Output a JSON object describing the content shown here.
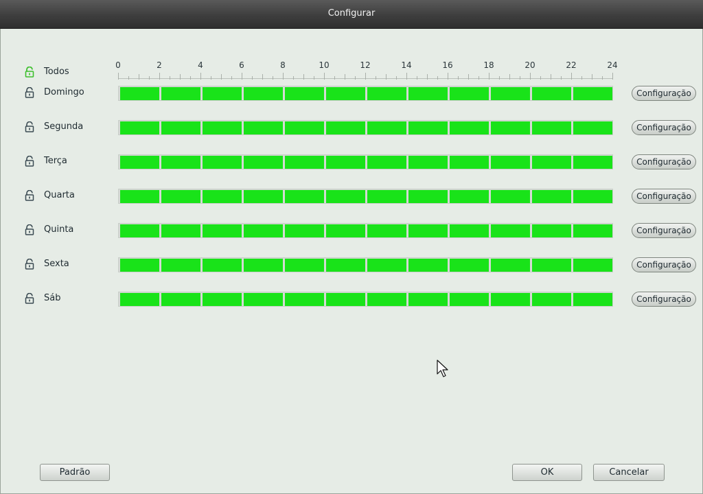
{
  "window": {
    "title": "Configurar"
  },
  "schedule": {
    "all_label": "Todos",
    "hour_ticks": [
      "0",
      "2",
      "4",
      "6",
      "8",
      "10",
      "12",
      "14",
      "16",
      "18",
      "20",
      "22",
      "24"
    ],
    "days": [
      {
        "label": "Domingo",
        "button": "Configuração",
        "active_hours": [
          0,
          24
        ]
      },
      {
        "label": "Segunda",
        "button": "Configuração",
        "active_hours": [
          0,
          24
        ]
      },
      {
        "label": "Terça",
        "button": "Configuração",
        "active_hours": [
          0,
          24
        ]
      },
      {
        "label": "Quarta",
        "button": "Configuração",
        "active_hours": [
          0,
          24
        ]
      },
      {
        "label": "Quinta",
        "button": "Configuração",
        "active_hours": [
          0,
          24
        ]
      },
      {
        "label": "Sexta",
        "button": "Configuração",
        "active_hours": [
          0,
          24
        ]
      },
      {
        "label": "Sáb",
        "button": "Configuração",
        "active_hours": [
          0,
          24
        ]
      }
    ]
  },
  "footer": {
    "default_label": "Padrão",
    "ok_label": "OK",
    "cancel_label": "Cancelar"
  },
  "colors": {
    "active": "#19e319",
    "all_lock": "#3cbf2c",
    "day_lock": "#3a4a52"
  },
  "icons": {
    "all_lock": "unlocked-padlock-icon",
    "day_lock": "unlocked-padlock-icon",
    "pointer": "mouse-pointer-icon"
  }
}
